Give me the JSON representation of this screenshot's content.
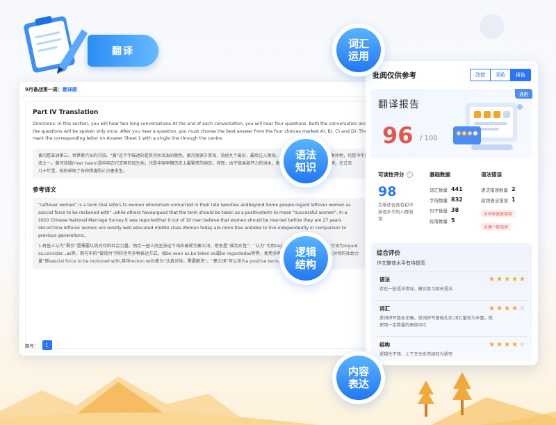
{
  "left_tag": "翻译",
  "bubbles": [
    {
      "id": "vocab",
      "lines": [
        "词汇",
        "运用"
      ]
    },
    {
      "id": "grammar",
      "lines": [
        "语法",
        "知识"
      ]
    },
    {
      "id": "logic",
      "lines": [
        "逻辑",
        "结构"
      ]
    },
    {
      "id": "content",
      "lines": [
        "内容",
        "表达"
      ]
    }
  ],
  "doc": {
    "header_prefix": "9月备战第一周：",
    "header_link": "翻译题",
    "part_title": "Part IV Translation",
    "directions": [
      "Directions: In this section, you will hear two long conversations At the end of each conversation, you will hear four questions. Both the conversation and",
      "the questions will be spoken only once. After you hear a question, you must choose the best answer from the four choices marked A), B), C) and D). Then",
      "mark the corresponding letter on Answer Sheet 1 with a single line through the centre."
    ],
    "chinese_text": [
      "黄河是亚洲第三、世界第六长的河流。“黄”这个字描述的是其河水浑浊的颜色。黄河发源于青海，流经九个省份，最后注入渤海。黄河流域是中国古代文明的发祥地，也是中华民族生存的几条河",
      "流之一。黄河流域(river basin)是中国古代文明的诞生地，也是中国早期历史上最繁荣的地区。然而，由于极易破坏力的洪水，黄河也给人们带来了巨大的灾害。在过去",
      "几十年里，政府采取了各种措施防止灾害发生。"
    ],
    "ref_title": "参考译文",
    "translation_en": [
      "“Leftover women” is a term that refers to women whoremain unmarried in their late twenties andbeyond.Some people regard leftover women as",
      "asocial force to be reckoned with” ,while others haveargued that the term should be taken as a positiveterm to mean “successful women”. In a",
      "2010 Chinese National Marriage Survey,it was reportedthat 9 out of 10 men believe that women should be married before they are 27 years",
      "old.InChina leftover women are mostly well-educated middle class.Women today are more free andable to live independently in comparison to",
      "previous generations.."
    ],
    "translation_notes": [
      "1.有些人认为“剩女”是需要认真对待的社会力量，而另一些人则主张这个词应被视为褒义词，意思是“成功女性”：“认为”可用regard...as,consider...as，可译为regard...",
      "as,consider...as等，而句中的“被视为”同样也有多种表达方式，如be seen as,be taken as或be regardedas等等，使用多种表达可避免句子重复，认真对待的社会力",
      "量”即asocial force to be reckoned with,其中reckon with意为“认真对待，需要解决”。“褒义词”可以译为a positive term。"
    ],
    "page_label": "题号：",
    "page_number": "1"
  },
  "report": {
    "title": "批阅仅供参考",
    "tabs": [
      "改错",
      "润色",
      "报告"
    ],
    "active_tab": "报告",
    "hero_title": "翻译报告",
    "badge": "通用",
    "score": "96",
    "score_total": "/ 100",
    "readability": {
      "label": "可读性评分",
      "help": "?",
      "value": "98",
      "desc": [
        "文章适合具有初中",
        "英语水平的人群阅",
        "读"
      ]
    },
    "basic": {
      "label": "基础数据",
      "rows": [
        {
          "k": "词汇数量",
          "v": "441"
        },
        {
          "k": "字符数量",
          "v": "832"
        },
        {
          "k": "句子数量",
          "v": "38"
        },
        {
          "k": "段落数量",
          "v": "5"
        }
      ]
    },
    "grammar": {
      "label": "语法错误",
      "rows": [
        {
          "k": "语法错误数量",
          "v": "2"
        },
        {
          "k": "高频语法错误",
          "v": "1"
        }
      ],
      "tags": [
        "名词单复数错误",
        "主谓一致错误"
      ]
    },
    "evaluation": {
      "title": "综合评价",
      "summary": "作文整体水平有待提高",
      "items": [
        {
          "name": "语法",
          "stars": 4.5,
          "desc": [
            "存在一些语法错误，建议复习相关语法"
          ]
        },
        {
          "name": "词汇",
          "stars": 4,
          "desc": [
            "单词拼写基本正确，单词拼写基础扎实;词汇量较为丰富，能",
            "使用一定数量的高级词汇"
          ]
        },
        {
          "name": "结构",
          "stars": 4,
          "desc": [
            "逻辑性不错，上下文关系衔接较为紧密"
          ]
        }
      ]
    }
  }
}
